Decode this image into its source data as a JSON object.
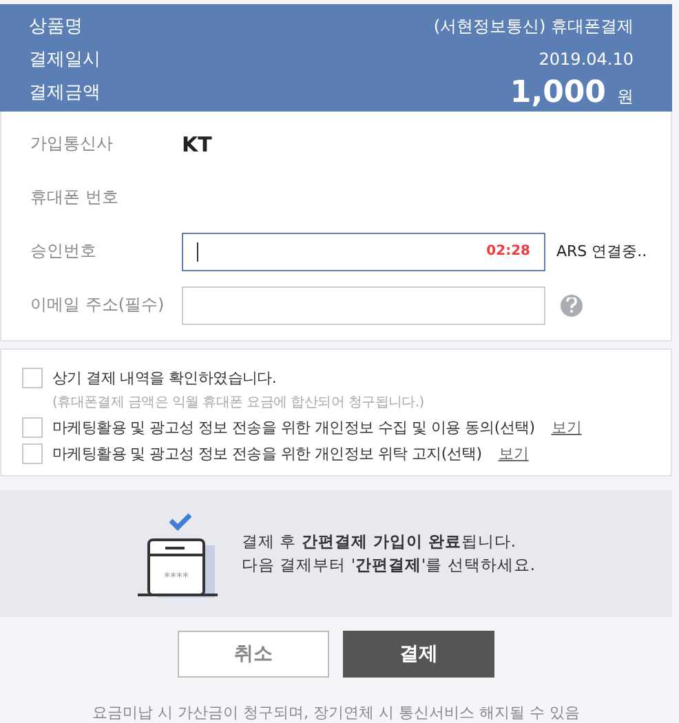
{
  "summary": [
    {
      "label": "상품명",
      "value": "(서현정보통신) 휴대폰결제",
      "kind": "text"
    },
    {
      "label": "결제일시",
      "value": "2019.04.10",
      "kind": "text"
    },
    {
      "label": "결제금액",
      "value": "1,000",
      "unit": "원",
      "kind": "amount"
    }
  ],
  "form": [
    {
      "label": "가입통신사",
      "value": "KT",
      "kind": "static"
    },
    {
      "label": "휴대폰 번호",
      "kind": "static"
    },
    {
      "label": "승인번호",
      "kind": "input",
      "focused": true,
      "timer": "02:28",
      "status": "ARS 연결중.."
    },
    {
      "label": "이메일 주소(필수)",
      "kind": "input",
      "focused": false,
      "help": true
    }
  ],
  "agreements": [
    {
      "label": "상기 결제 내역을 확인하였습니다.",
      "note": "(휴대폰결제 금액은 익월 휴대폰 요금에 합산되어 청구됩니다.)",
      "checked": false
    },
    {
      "label": "마케팅활용 및 광고성 정보 전송을 위한 개인정보 수집 및 이용 동의(선택)",
      "link": "보기",
      "checked": false
    },
    {
      "label": "마케팅활용 및 광고성 정보 전송을 위한 개인정보 위탁 고지(선택)",
      "link": "보기",
      "checked": false
    }
  ],
  "info": {
    "lines": [
      "결제 후 **간편결제 가입이 완료**됩니다.",
      "다음 결제부터 '**간편결제**'를 선택하세요."
    ],
    "card_mask": "****"
  },
  "buttons": [
    {
      "label": "취소",
      "kind": "secondary"
    },
    {
      "label": "결제",
      "kind": "primary"
    }
  ],
  "footer": "요금미납 시 가산금이 청구되며, 장기연체 시 통신서비스 해지될 수 있음"
}
